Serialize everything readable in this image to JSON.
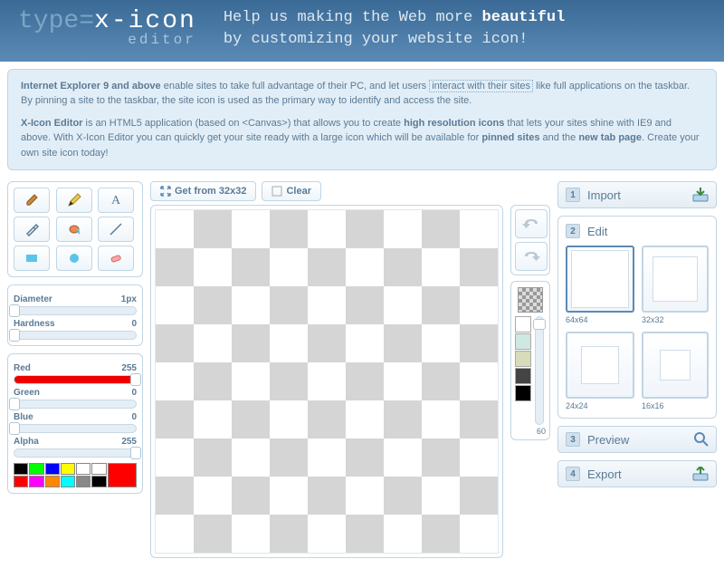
{
  "header": {
    "logo_prefix": "type=",
    "logo_main": "x-icon",
    "logo_sub": "editor",
    "tagline1_a": "Help us making the Web more ",
    "tagline1_b": "beautiful",
    "tagline2": "by customizing your website icon!"
  },
  "info": {
    "p1_a": "Internet Explorer 9 and above",
    "p1_b": " enable sites to take full advantage of their PC, and let users ",
    "p1_link": "interact with their sites",
    "p1_c": " like full applications on the taskbar. By pinning a site to the taskbar, the site icon is used as the primary way to identify and access the site.",
    "p2_a": "X-Icon Editor",
    "p2_b": " is an HTML5 application (based on <Canvas>) that allows you to create ",
    "p2_c": "high resolution icons",
    "p2_d": " that lets your sites shine with IE9 and above. With X-Icon Editor you can quickly get your site ready with a large icon which will be available for ",
    "p2_e": "pinned sites",
    "p2_f": " and the ",
    "p2_g": "new tab page",
    "p2_h": ". Create your own site icon today!"
  },
  "tools": [
    "brush",
    "pencil",
    "text",
    "eyedropper",
    "bucket",
    "line",
    "rectangle",
    "circle",
    "eraser"
  ],
  "sliders": {
    "diameter": {
      "label": "Diameter",
      "value": "1px",
      "pos": 0
    },
    "hardness": {
      "label": "Hardness",
      "value": "0",
      "pos": 0
    },
    "red": {
      "label": "Red",
      "value": "255",
      "pos": 100,
      "color": "#e00"
    },
    "green": {
      "label": "Green",
      "value": "0",
      "pos": 0,
      "color": "#0a0"
    },
    "blue": {
      "label": "Blue",
      "value": "0",
      "pos": 0,
      "color": "#06c"
    },
    "alpha": {
      "label": "Alpha",
      "value": "255",
      "pos": 100
    }
  },
  "swatches": [
    "#000",
    "#0f0",
    "#00f",
    "#ff0",
    "#fff",
    "#fff",
    "#f00",
    "#f0f",
    "#f80",
    "#0ff",
    "#888",
    "#000"
  ],
  "current_color": "#f00",
  "buttons": {
    "get_from": "Get from 32x32",
    "clear": "Clear"
  },
  "side": {
    "fill_value": "60",
    "swatches": [
      "#fff",
      "#cfe8e2",
      "#d8dcb8",
      "#444",
      "#000"
    ]
  },
  "steps": {
    "import": {
      "num": "1",
      "label": "Import"
    },
    "edit": {
      "num": "2",
      "label": "Edit"
    },
    "preview": {
      "num": "3",
      "label": "Preview"
    },
    "export": {
      "num": "4",
      "label": "Export"
    }
  },
  "sizes": [
    {
      "label": "64x64",
      "dim": 64,
      "active": true
    },
    {
      "label": "32x32",
      "dim": 50,
      "active": false
    },
    {
      "label": "24x24",
      "dim": 42,
      "active": false
    },
    {
      "label": "16x16",
      "dim": 34,
      "active": false
    }
  ]
}
